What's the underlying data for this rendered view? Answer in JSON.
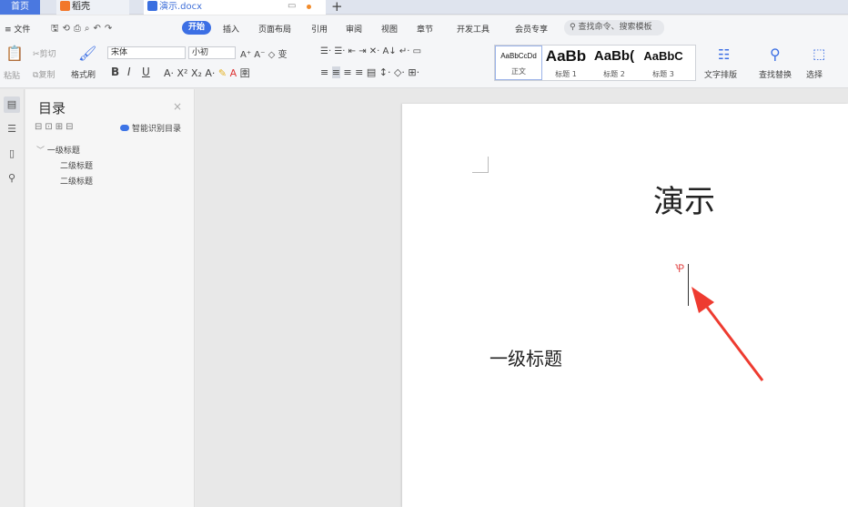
{
  "tabs": {
    "home": "首页",
    "daoke": "稻壳",
    "doc": "演示.docx"
  },
  "menu": {
    "file": "≡ 文件",
    "start": "开始",
    "items": [
      "插入",
      "页面布局",
      "引用",
      "审阅",
      "视图",
      "章节",
      "开发工具",
      "会员专享"
    ],
    "search_placeholder": "查找命令、搜索模板"
  },
  "ribbon": {
    "paste": "粘贴",
    "cut": "剪切",
    "copy": "复制",
    "format_painter": "格式刷",
    "font_name": "宋体",
    "font_size": "小初",
    "styles": [
      {
        "sample": "AaBbCcDd",
        "name": "正文"
      },
      {
        "sample": "AaBb",
        "name": "标题 1"
      },
      {
        "sample": "AaBb(",
        "name": "标题 2"
      },
      {
        "sample": "AaBbC",
        "name": "标题 3"
      }
    ],
    "text_layout": "文字排版",
    "find_replace": "查找替换",
    "select": "选择"
  },
  "toc": {
    "title": "目录",
    "smart": "智能识别目录",
    "entries": [
      "一级标题",
      "二级标题",
      "二级标题"
    ]
  },
  "document": {
    "title": "演示",
    "heading1": "一级标题"
  },
  "colors": {
    "accent": "#3c6fe4",
    "arrow": "#ee3b30"
  }
}
